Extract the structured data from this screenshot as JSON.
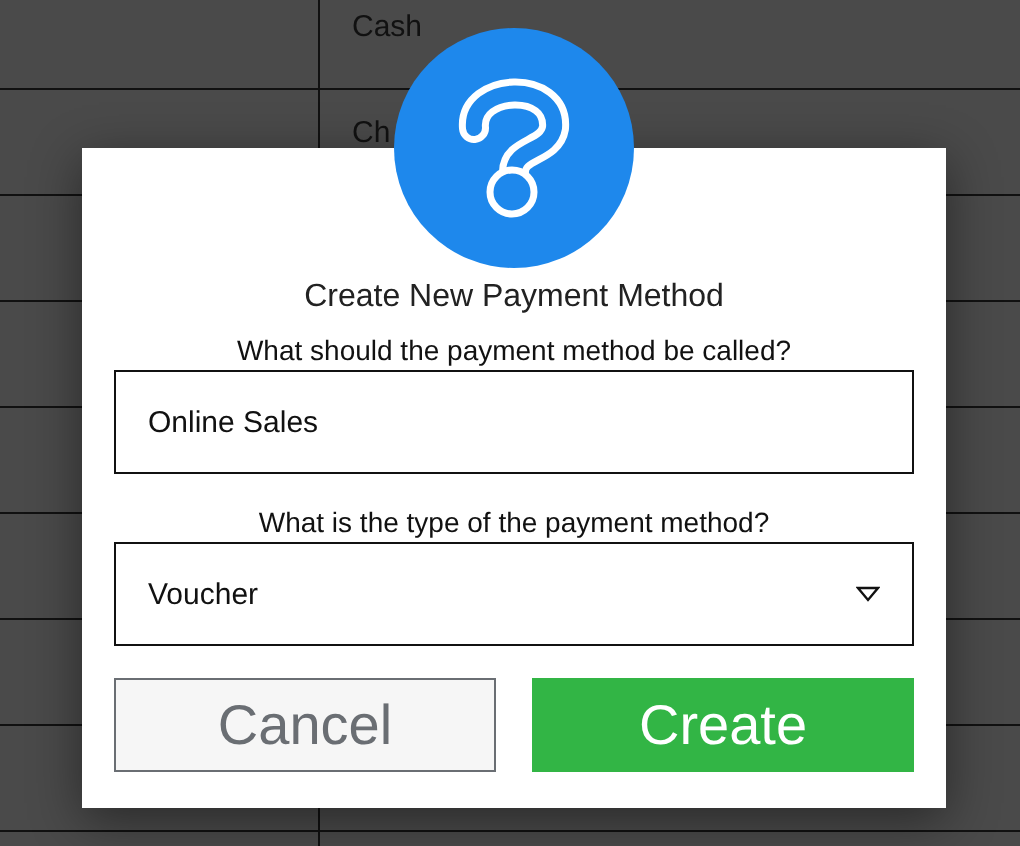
{
  "background_table": {
    "rows": [
      {
        "column_2": "Cash"
      },
      {
        "column_2": "Ch"
      }
    ]
  },
  "dialog": {
    "title": "Create New Payment Method",
    "name_field": {
      "label": "What should the payment method be called?",
      "value": "Online Sales"
    },
    "type_select": {
      "label": "What is the type of the payment method?",
      "value": "Voucher"
    },
    "buttons": [
      {
        "label": "Cancel",
        "kind": "cancel"
      },
      {
        "label": "Create",
        "kind": "primary"
      }
    ]
  }
}
